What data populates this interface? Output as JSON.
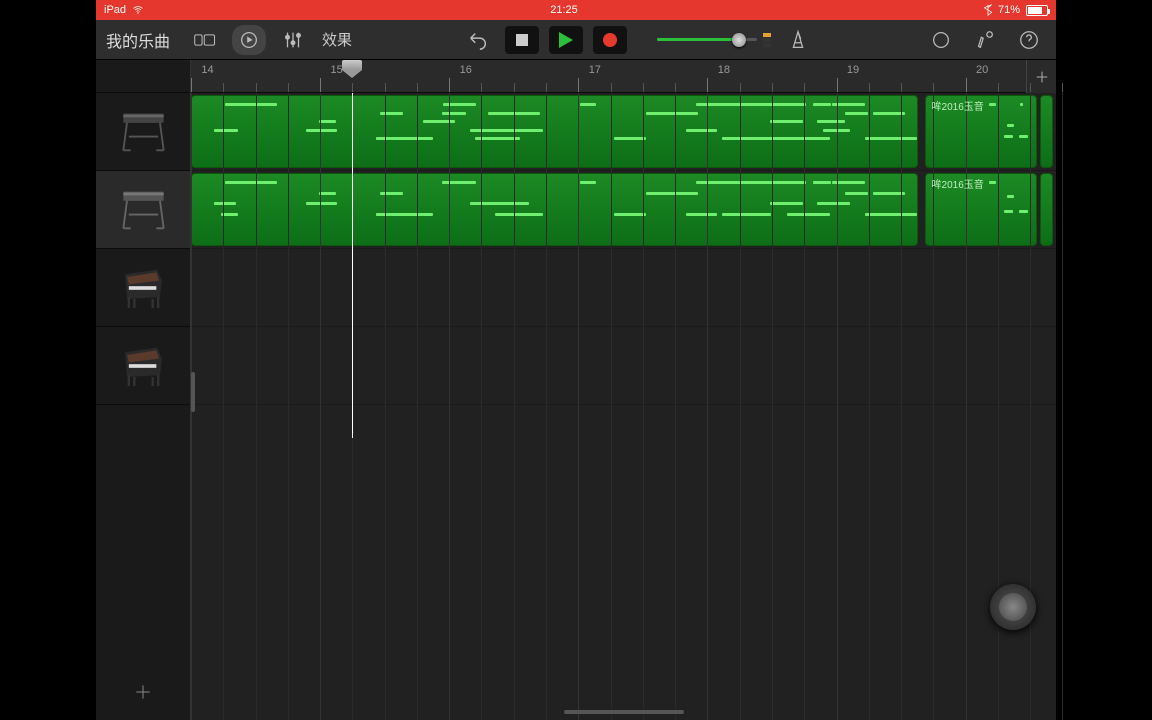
{
  "status": {
    "device": "iPad",
    "time": "21:25",
    "battery": "71%"
  },
  "toolbar": {
    "song_title": "我的乐曲",
    "fx_label": "效果"
  },
  "ruler": {
    "bars": [
      14,
      15,
      16,
      17,
      18,
      19,
      20
    ]
  },
  "tracks": [
    {
      "instrument": "keyboard-stand",
      "selected": false
    },
    {
      "instrument": "keyboard-stand",
      "selected": true
    },
    {
      "instrument": "grand-piano",
      "selected": false
    },
    {
      "instrument": "grand-piano",
      "selected": false
    }
  ],
  "clips": {
    "tail_label": "哞2016玉音"
  },
  "playhead": {
    "bar": 15
  },
  "volume": {
    "level": 0.82
  }
}
